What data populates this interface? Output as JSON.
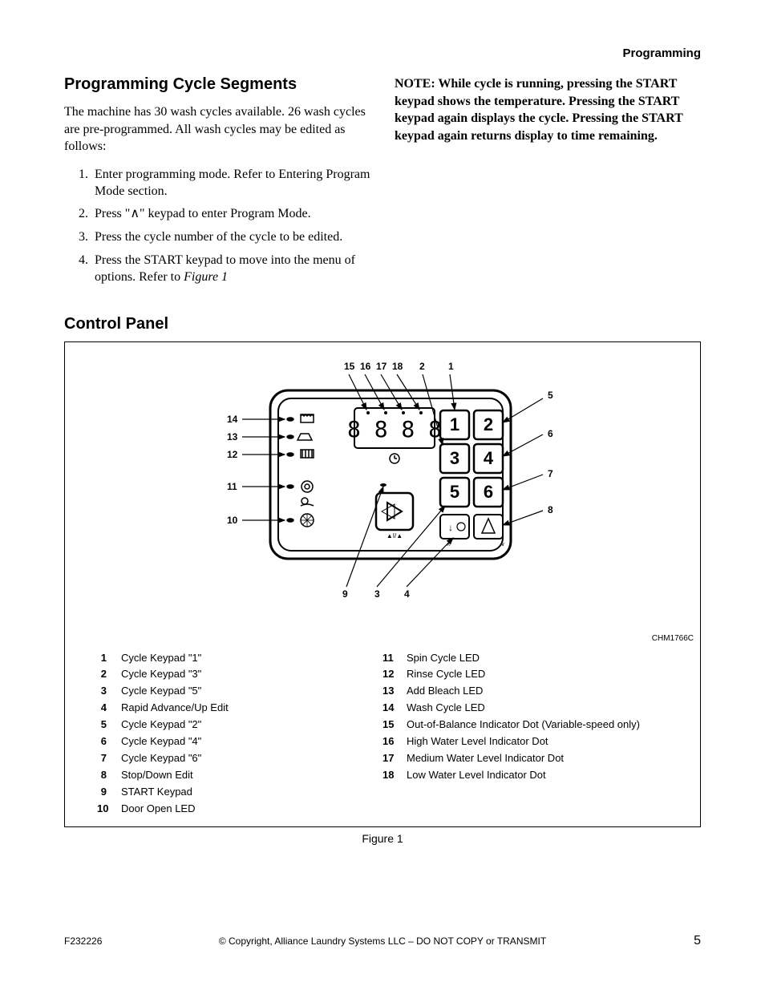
{
  "header": {
    "section_label": "Programming"
  },
  "left": {
    "title": "Programming Cycle Segments",
    "intro": "The machine has 30 wash cycles available.  26 wash cycles are pre-programmed.   All wash cycles may be edited as follows:",
    "steps": [
      "Enter programming mode.  Refer to Entering Program Mode section.",
      "Press \"∧\" keypad to enter Program Mode.",
      "Press the cycle number of the cycle to be edited.",
      "Press the START keypad to move into the menu of options. Refer to "
    ],
    "step4_ref": "Figure 1"
  },
  "right": {
    "note": "NOTE: While cycle is running, pressing the START keypad shows the temperature. Pressing the START keypad again displays the cycle. Pressing the START keypad again returns display to time remaining."
  },
  "control_panel": {
    "title": "Control Panel",
    "diagram_code": "CHM1766C",
    "callout_labels": {
      "top": [
        "15",
        "16",
        "17",
        "18",
        "2",
        "1"
      ],
      "left": [
        "14",
        "13",
        "12",
        "11",
        "10"
      ],
      "right": [
        "5",
        "6",
        "7",
        "8"
      ],
      "bottom": [
        "9",
        "3",
        "4"
      ]
    },
    "keypad_labels": [
      "1",
      "2",
      "3",
      "4",
      "5",
      "6"
    ],
    "display_digits": "8888",
    "legend_left": [
      {
        "n": "1",
        "t": "Cycle Keypad \"1\""
      },
      {
        "n": "2",
        "t": "Cycle Keypad \"3\""
      },
      {
        "n": "3",
        "t": "Cycle Keypad \"5\""
      },
      {
        "n": "4",
        "t": "Rapid Advance/Up Edit"
      },
      {
        "n": "5",
        "t": "Cycle Keypad \"2\""
      },
      {
        "n": "6",
        "t": "Cycle Keypad \"4\""
      },
      {
        "n": "7",
        "t": "Cycle Keypad \"6\""
      },
      {
        "n": "8",
        "t": "Stop/Down Edit"
      },
      {
        "n": "9",
        "t": "START Keypad"
      },
      {
        "n": "10",
        "t": "Door Open LED"
      }
    ],
    "legend_right": [
      {
        "n": "11",
        "t": "Spin Cycle LED"
      },
      {
        "n": "12",
        "t": "Rinse Cycle LED"
      },
      {
        "n": "13",
        "t": "Add Bleach LED"
      },
      {
        "n": "14",
        "t": "Wash Cycle LED"
      },
      {
        "n": "15",
        "t": "Out-of-Balance Indicator Dot (Variable-speed only)"
      },
      {
        "n": "16",
        "t": "High Water Level Indicator Dot"
      },
      {
        "n": "17",
        "t": "Medium Water Level Indicator Dot"
      },
      {
        "n": "18",
        "t": "Low Water Level Indicator Dot"
      }
    ],
    "caption": "Figure 1"
  },
  "footer": {
    "left": "F232226",
    "center": "© Copyright, Alliance Laundry Systems LLC – DO NOT COPY or TRANSMIT",
    "right": "5"
  }
}
